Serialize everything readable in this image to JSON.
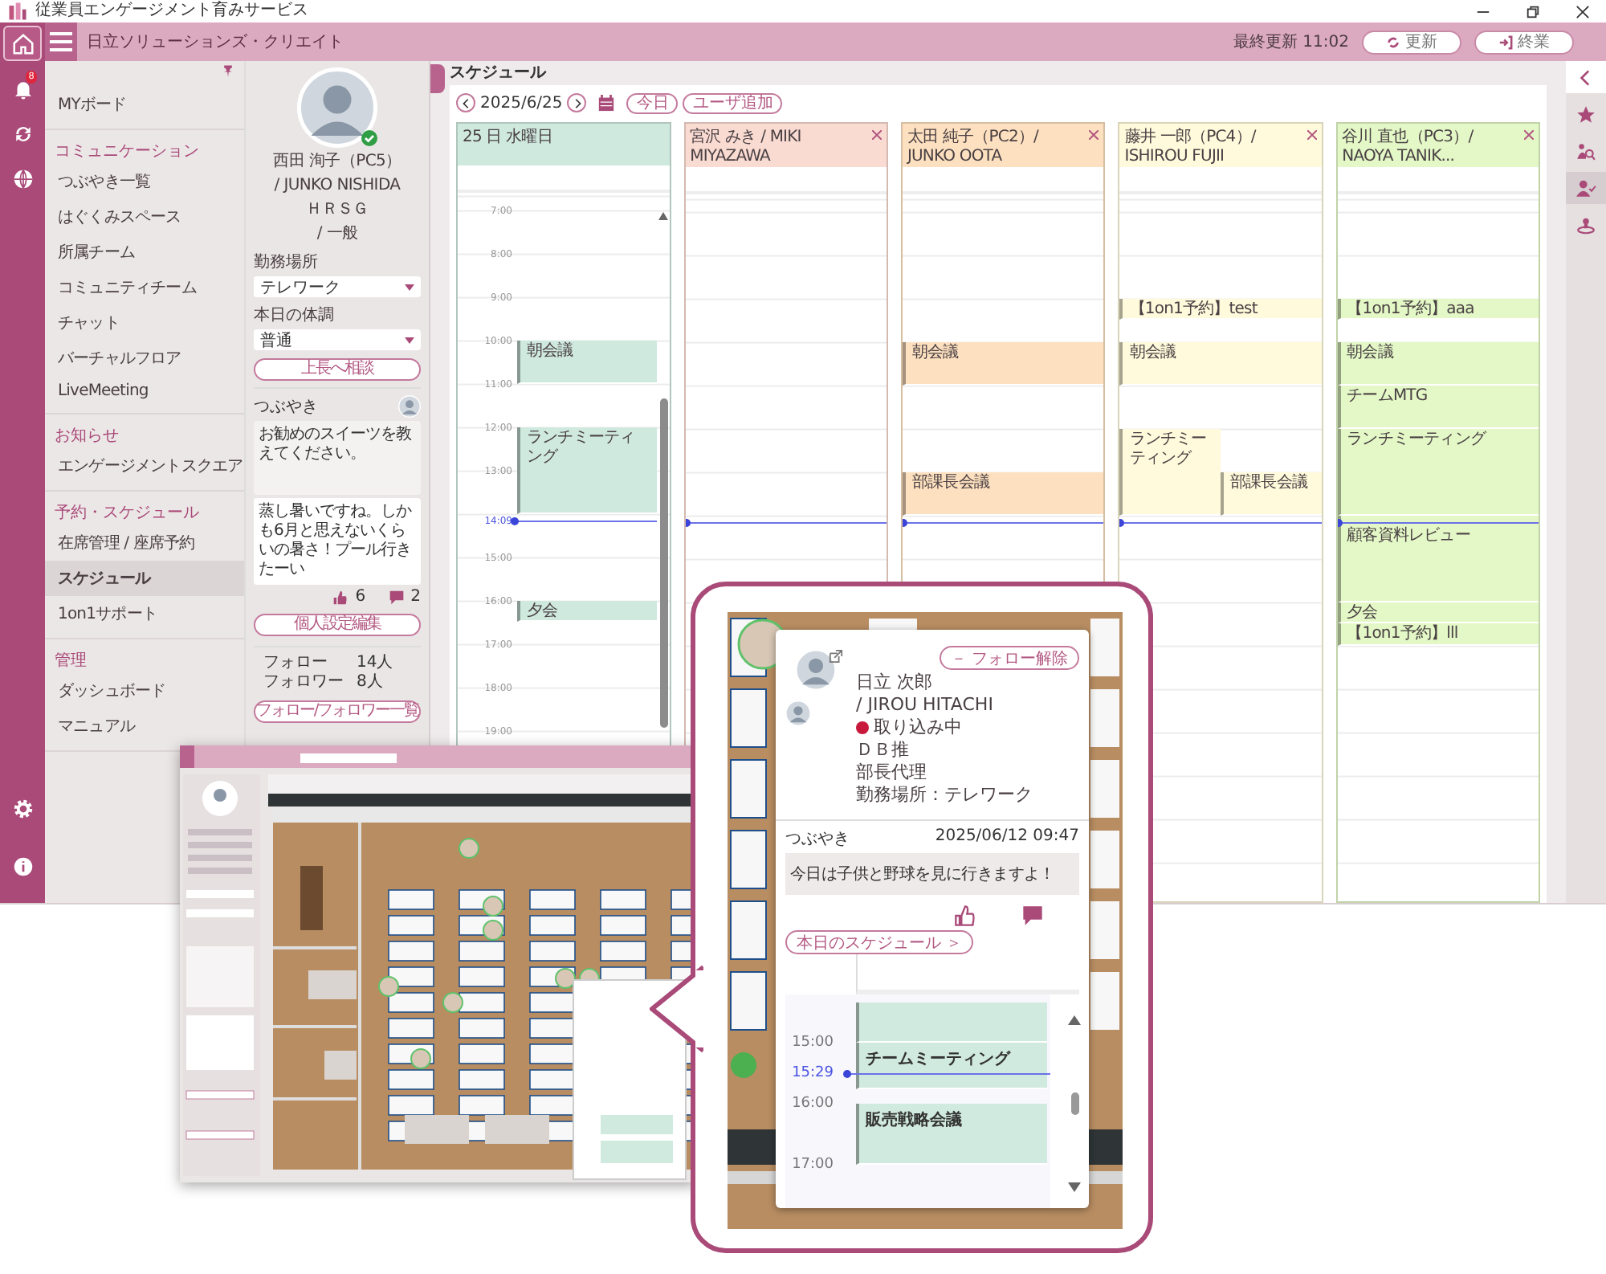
{
  "title_bar": {
    "title": "従業員エンゲージメント育みサービス"
  },
  "header": {
    "company": "日立ソリューションズ・クリエイト",
    "last_updated_label": "最終更新",
    "last_updated": "11:02",
    "refresh_button": "更新",
    "finish_button": "終業"
  },
  "rail": {
    "items": [
      {
        "selected": true
      },
      {
        "selected": false,
        "badge": "8"
      },
      {
        "selected": false
      },
      {
        "selected": false
      }
    ]
  },
  "nav": {
    "sections": [
      {
        "items": [
          {
            "label": "MYボード",
            "selected": false
          }
        ]
      },
      {
        "heading": "コミュニケーション",
        "items": [
          {
            "label": "つぶやき一覧",
            "selected": false
          },
          {
            "label": "はぐくみスペース",
            "selected": false
          },
          {
            "label": "所属チーム",
            "selected": false
          },
          {
            "label": "コミュニティチーム",
            "selected": false
          },
          {
            "label": "チャット",
            "selected": false
          },
          {
            "label": "バーチャルフロア",
            "selected": false
          },
          {
            "label": "LiveMeeting",
            "selected": false
          }
        ]
      },
      {
        "heading": "お知らせ",
        "items": [
          {
            "label": "エンゲージメントスクエア",
            "selected": false
          }
        ]
      },
      {
        "heading": "予約・スケジュール",
        "items": [
          {
            "label": "在席管理 / 座席予約",
            "selected": false
          },
          {
            "label": "スケジュール",
            "selected": true
          },
          {
            "label": "1on1サポート",
            "selected": false
          }
        ]
      },
      {
        "heading": "管理",
        "items": [
          {
            "label": "ダッシュボード",
            "selected": false
          },
          {
            "label": "マニュアル",
            "selected": false
          }
        ]
      }
    ]
  },
  "profile": {
    "name": "西田 洵子（PC5）",
    "name_en": "/ JUNKO NISHIDA",
    "department": "ＨＲＳＧ",
    "role": "/ 一般",
    "online": true,
    "fields": [
      {
        "label": "勤務場所",
        "value": "テレワーク"
      },
      {
        "label": "本日の体調",
        "value": "普通"
      }
    ],
    "consult_button": "上長へ相談",
    "tweets_label": "つぶやき",
    "tweets": [
      "お勧めのスイーツを教えてください。",
      "蒸し暑いですね。しかも6月と思えないくらいの暑さ！プール行きたーい"
    ],
    "likes": "6",
    "comments": "2",
    "settings_button": "個人設定編集",
    "follows": [
      {
        "label": "フォロー",
        "count": "14人"
      },
      {
        "label": "フォロワー",
        "count": "8人"
      }
    ],
    "follow_list_button": "フォロー/フォロワー一覧"
  },
  "schedule": {
    "title": "スケジュール",
    "date": "2025/6/25",
    "today_button": "今日",
    "add_user_button": "ユーザ追加",
    "now": "14:09",
    "time_labels": [
      "7:00",
      "8:00",
      "9:00",
      "10:00",
      "11:00",
      "12:00",
      "13:00",
      "15:00",
      "16:00",
      "17:00",
      "18:00",
      "19:00"
    ],
    "columns": [
      {
        "header": "25 日 水曜日",
        "color": "#cfe9df",
        "closable": false,
        "events": [
          {
            "title": "朝会議"
          },
          {
            "title": "ランチミーティング"
          },
          {
            "title": "夕会"
          }
        ]
      },
      {
        "header": "宮沢 みき / MIKI MIYAZAWA",
        "color": "#f9dbd1",
        "closable": true
      },
      {
        "header": "太田 純子（PC2）/ JUNKO OOTA",
        "color": "#fde0bf",
        "closable": true,
        "events": [
          {
            "title": "朝会議"
          },
          {
            "title": "部課長会議"
          }
        ]
      },
      {
        "header": "藤井 一郎（PC4）/ ISHIROU FUJII",
        "color": "#fffadb",
        "closable": true,
        "events": [
          {
            "title": "【1on1予約】test"
          },
          {
            "title": "朝会議"
          },
          {
            "title": "ランチミーティング"
          },
          {
            "title": "部課長会議"
          }
        ]
      },
      {
        "header": "谷川 直也（PC3）/ NAOYA TANIK...",
        "color": "#e3f8c6",
        "closable": true,
        "events": [
          {
            "title": "【1on1予約】aaa"
          },
          {
            "title": "朝会議"
          },
          {
            "title": "チームMTG"
          },
          {
            "title": "ランチミーティング"
          },
          {
            "title": "顧客資料レビュー"
          },
          {
            "title": "夕会"
          },
          {
            "title": "【1on1予約】lll"
          }
        ]
      }
    ]
  },
  "right_rail": {
    "items": [
      {
        "selected": false
      },
      {
        "selected": false
      },
      {
        "selected": true
      },
      {
        "selected": false
      }
    ]
  },
  "callout": {
    "follow_button": "－ フォロー解除",
    "name": "日立 次郎",
    "name_en": "/ JIROU HITACHI",
    "status": {
      "label": "取り込み中",
      "color": "#c8193c"
    },
    "lines": [
      "ＤＢ推",
      "部長代理",
      "勤務場所：テレワーク"
    ],
    "tweet_label": "つぶやき",
    "tweet_time": "2025/06/12 09:47",
    "tweet": "今日は子供と野球を見に行きますよ！",
    "schedule_button": "本日のスケジュール ＞",
    "mini_schedule": {
      "time_labels": [
        "15:00",
        "16:00",
        "17:00"
      ],
      "now": "15:29",
      "events": [
        {
          "title": "チームミーティング"
        },
        {
          "title": "販売戦略会議"
        }
      ]
    }
  }
}
